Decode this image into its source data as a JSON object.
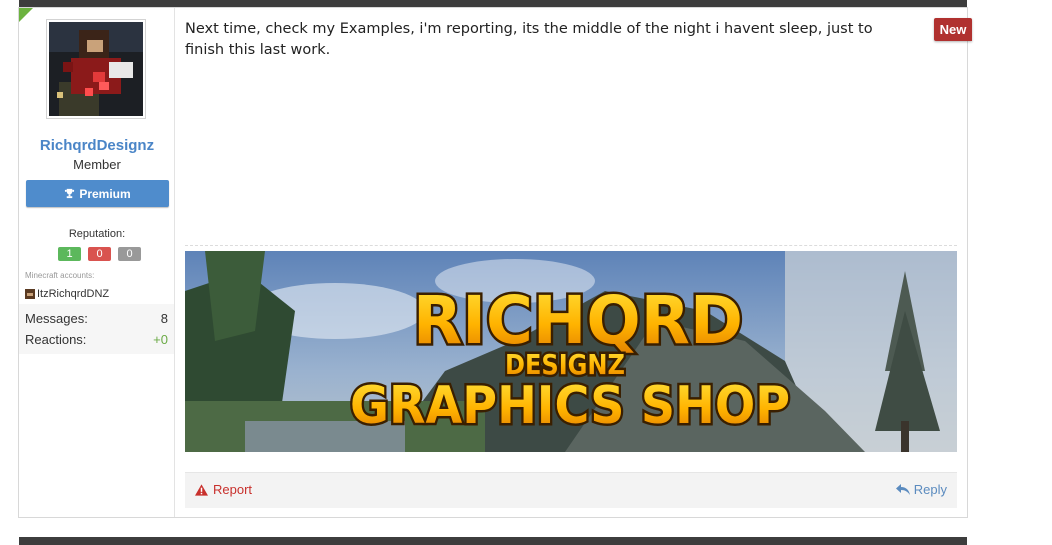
{
  "user": {
    "username": "RichqrdDesignz",
    "title": "Member",
    "premium_label": "Premium",
    "reputation_label": "Reputation:",
    "reputation": {
      "positive": "1",
      "negative": "0",
      "neutral": "0"
    },
    "minecraft_label": "Minecraft accounts:",
    "minecraft_account": "ItzRichqrdDNZ",
    "stats": [
      {
        "label": "Messages:",
        "value": "8"
      },
      {
        "label": "Reactions:",
        "value": "+0"
      }
    ]
  },
  "post": {
    "message": "Next time, check my Examples, i'm reporting, its the middle of the night i havent sleep, just to finish this last work.",
    "badge": "New",
    "banner": {
      "line1": "RICHQRD",
      "line2": "DESIGNZ",
      "line3": "GRAPHICS SHOP"
    },
    "report_label": "Report",
    "reply_label": "Reply"
  },
  "colors": {
    "accent": "#4a85c7",
    "premium": "#4f8ccc",
    "new_badge": "#b0312f",
    "report": "#c8302c",
    "reply": "#5b8bbf",
    "corner": "#6cb33f"
  },
  "icons": [
    "trophy-icon",
    "warning-icon",
    "reply-icon"
  ]
}
